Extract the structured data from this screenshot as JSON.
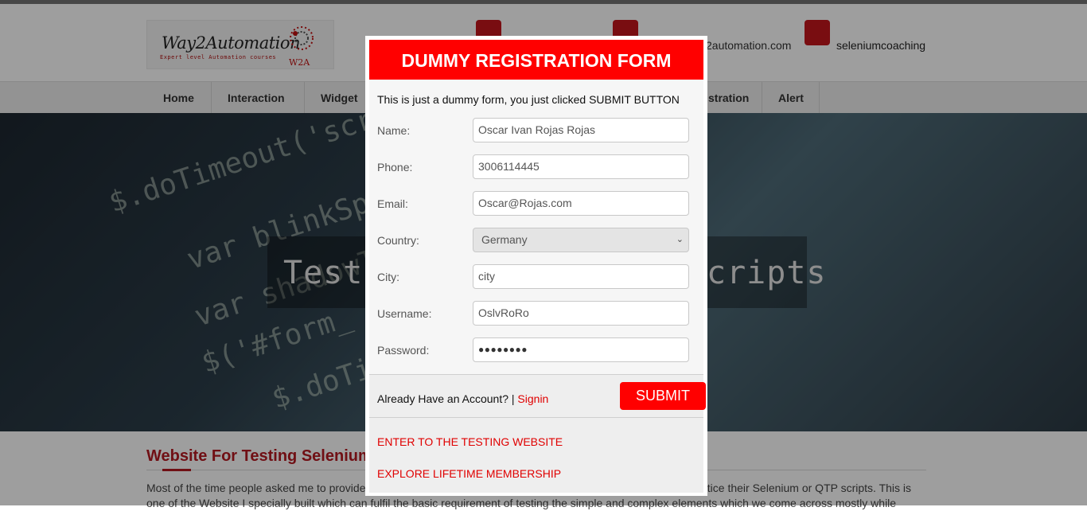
{
  "header": {
    "logo_brand": "Way2Automation",
    "logo_tagline": "Expert level Automation courses",
    "logo_mark": "W2A",
    "contact_email_partial": "2automation.com",
    "skype_id": "seleniumcoaching"
  },
  "nav": {
    "items": [
      "Home",
      "Interaction",
      "Widget",
      "stration",
      "Alert"
    ]
  },
  "hero": {
    "title_left": "Test",
    "title_right": "cripts",
    "code_lines": [
      "$.doTimeout('scr",
      "var blinkSpe",
      "var shadowT",
      "$('#form_",
      "$.doTi"
    ]
  },
  "section": {
    "title": "Website For Testing Selenium",
    "text_line1_left": "Most of the time people asked me to provide",
    "text_line1_right": "actice their Selenium or QTP scripts. This is",
    "text_line2": "one of the Website I specially built which can fulfil the basic requirement of testing the simple and complex elements which we come across mostly while"
  },
  "modal": {
    "title": "DUMMY REGISTRATION FORM",
    "intro": "This is just a dummy form, you just clicked SUBMIT BUTTON",
    "fields": {
      "name": {
        "label": "Name:",
        "value": "Oscar Ivan Rojas Rojas"
      },
      "phone": {
        "label": "Phone:",
        "value": "3006114445"
      },
      "email": {
        "label": "Email:",
        "value": "Oscar@Rojas.com"
      },
      "country": {
        "label": "Country:",
        "value": "Germany"
      },
      "city": {
        "label": "City:",
        "value": "city"
      },
      "username": {
        "label": "Username:",
        "value": "OslvRoRo"
      },
      "password": {
        "label": "Password:",
        "value": "●●●●●●●●"
      }
    },
    "already_text": "Already Have an Account? |",
    "signin_label": "Signin",
    "submit_label": "SUBMIT",
    "link_enter": "ENTER TO THE TESTING WEBSITE",
    "link_membership": "EXPLORE LIFETIME MEMBERSHIP"
  },
  "colors": {
    "accent_red": "#ff0000",
    "brand_red": "#b51921",
    "overlay": "rgba(0,0,0,0.38)"
  }
}
